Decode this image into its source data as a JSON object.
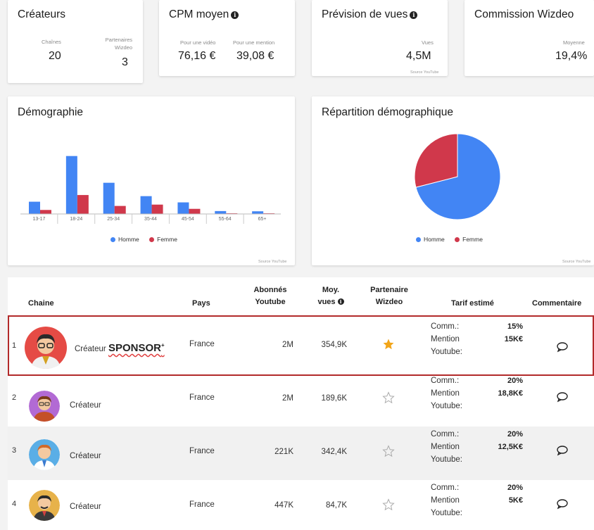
{
  "cards": {
    "createurs": {
      "title": "Créateurs",
      "chaines_label": "Chaînes",
      "chaines_value": "20",
      "partenaires_label_1": "Partenaires",
      "partenaires_label_2": "Wizdeo",
      "partenaires_value": "3"
    },
    "cpm": {
      "title": "CPM moyen",
      "video_label": "Pour une vidéo",
      "video_value": "76,16 €",
      "mention_label": "Pour une mention",
      "mention_value": "39,08 €"
    },
    "prevision": {
      "title": "Prévision de vues",
      "vues_label": "Vues",
      "vues_value": "4,5M",
      "source": "Source YouTube"
    },
    "commission": {
      "title": "Commission Wizdeo",
      "moyenne_label": "Moyenne",
      "moyenne_value": "19,4%"
    }
  },
  "demographie": {
    "title": "Démographie",
    "source": "Source YouTube",
    "legend": [
      {
        "label": "Homme",
        "color": "#4285f4"
      },
      {
        "label": "Femme",
        "color": "#d0384b"
      }
    ]
  },
  "repartition": {
    "title": "Répartition démographique",
    "source": "Source YouTube",
    "legend": [
      {
        "label": "Homme",
        "color": "#4285f4"
      },
      {
        "label": "Femme",
        "color": "#d0384b"
      }
    ]
  },
  "chart_data": [
    {
      "type": "bar",
      "title": "Démographie",
      "categories": [
        "13-17",
        "18-24",
        "25-34",
        "35-44",
        "45-54",
        "55-64",
        "65+"
      ],
      "series": [
        {
          "name": "Homme",
          "color": "#4285f4",
          "values": [
            5.5,
            26,
            14,
            8,
            5.2,
            1.3,
            1.2
          ]
        },
        {
          "name": "Femme",
          "color": "#d0384b",
          "values": [
            1.8,
            8.5,
            3.6,
            4.2,
            2.3,
            0.3,
            0.3
          ]
        }
      ],
      "ylim": [
        0,
        30
      ],
      "legend": "bottom"
    },
    {
      "type": "pie",
      "title": "Répartition démographique",
      "labels": [
        "Homme",
        "Femme"
      ],
      "values": [
        71,
        29
      ],
      "colors": [
        "#4285f4",
        "#d0384b"
      ],
      "legend": "bottom"
    }
  ],
  "table": {
    "headers": {
      "chaine": "Chaine",
      "pays": "Pays",
      "abonnes_1": "Abonnés",
      "abonnes_2": "Youtube",
      "moy_1": "Moy.",
      "moy_2": "vues",
      "part_1": "Partenaire",
      "part_2": "Wizdeo",
      "tarif": "Tarif estimé",
      "commentaire": "Commentaire"
    },
    "tarif_labels": {
      "comm": "Comm.:",
      "mention": "Mention",
      "youtube": "Youtube:"
    },
    "rows": [
      {
        "num": "1",
        "name": "Créateur",
        "badge": "SPONSOR",
        "badge_sup": "+",
        "pays": "France",
        "abonnes": "2M",
        "vues": "354,9K",
        "partenaire": true,
        "comm": "15%",
        "mention": "15K€"
      },
      {
        "num": "2",
        "name": "Créateur",
        "pays": "France",
        "abonnes": "2M",
        "vues": "189,6K",
        "partenaire": false,
        "comm": "20%",
        "mention": "18,8K€"
      },
      {
        "num": "3",
        "name": "Créateur",
        "pays": "France",
        "abonnes": "221K",
        "vues": "342,4K",
        "partenaire": false,
        "comm": "20%",
        "mention": "12,5K€"
      },
      {
        "num": "4",
        "name": "Créateur",
        "pays": "France",
        "abonnes": "447K",
        "vues": "84,7K",
        "partenaire": false,
        "comm": "20%",
        "mention": "5K€"
      }
    ]
  },
  "colors": {
    "accent_blue": "#4285f4",
    "accent_red": "#d0384b",
    "highlight_border": "#b22a2a",
    "star": "#f2a519"
  }
}
